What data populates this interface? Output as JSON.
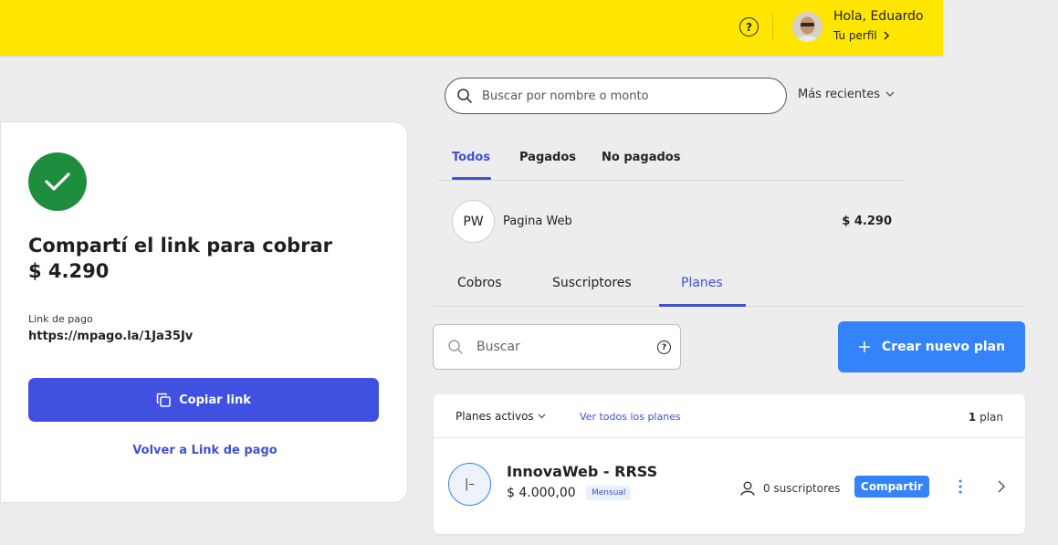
{
  "header": {
    "help_label": "?",
    "greeting": "Hola, Eduardo",
    "profile_link": "Tu perfil",
    "brand_color": "#ffe600"
  },
  "payment_card": {
    "title": "Compartí el link para cobrar",
    "amount": "$ 4.290",
    "link_label": "Link de pago",
    "link_value": "https://mpago.la/1Ja35Jv",
    "copy_button": "Copiar link",
    "back_link": "Volver a Link de pago",
    "success_color": "#1e8e3e"
  },
  "payments": {
    "search_placeholder": "Buscar por nombre o monto",
    "sort_label": "Más recientes",
    "tabs": [
      "Todos",
      "Pagados",
      "No pagados"
    ],
    "active_tab": "Todos",
    "items": [
      {
        "initials": "PW",
        "name": "Pagina Web",
        "amount": "$ 4.290"
      }
    ]
  },
  "section_tabs": {
    "tabs": [
      "Cobros",
      "Suscriptores",
      "Planes"
    ],
    "active": "Planes"
  },
  "plans": {
    "search_placeholder": "Buscar",
    "search_help": "?",
    "create_button": "Crear nuevo plan",
    "filter_label": "Planes activos",
    "view_all": "Ver todos los planes",
    "count_number": "1",
    "count_label": "plan",
    "items": [
      {
        "icon_text": "|–",
        "name": "InnovaWeb - RRSS",
        "price": "$ 4.000,00",
        "frequency": "Mensual",
        "subscribers": "0 suscriptores",
        "share_button": "Compartir"
      }
    ],
    "accent_color": "#3483fa"
  }
}
